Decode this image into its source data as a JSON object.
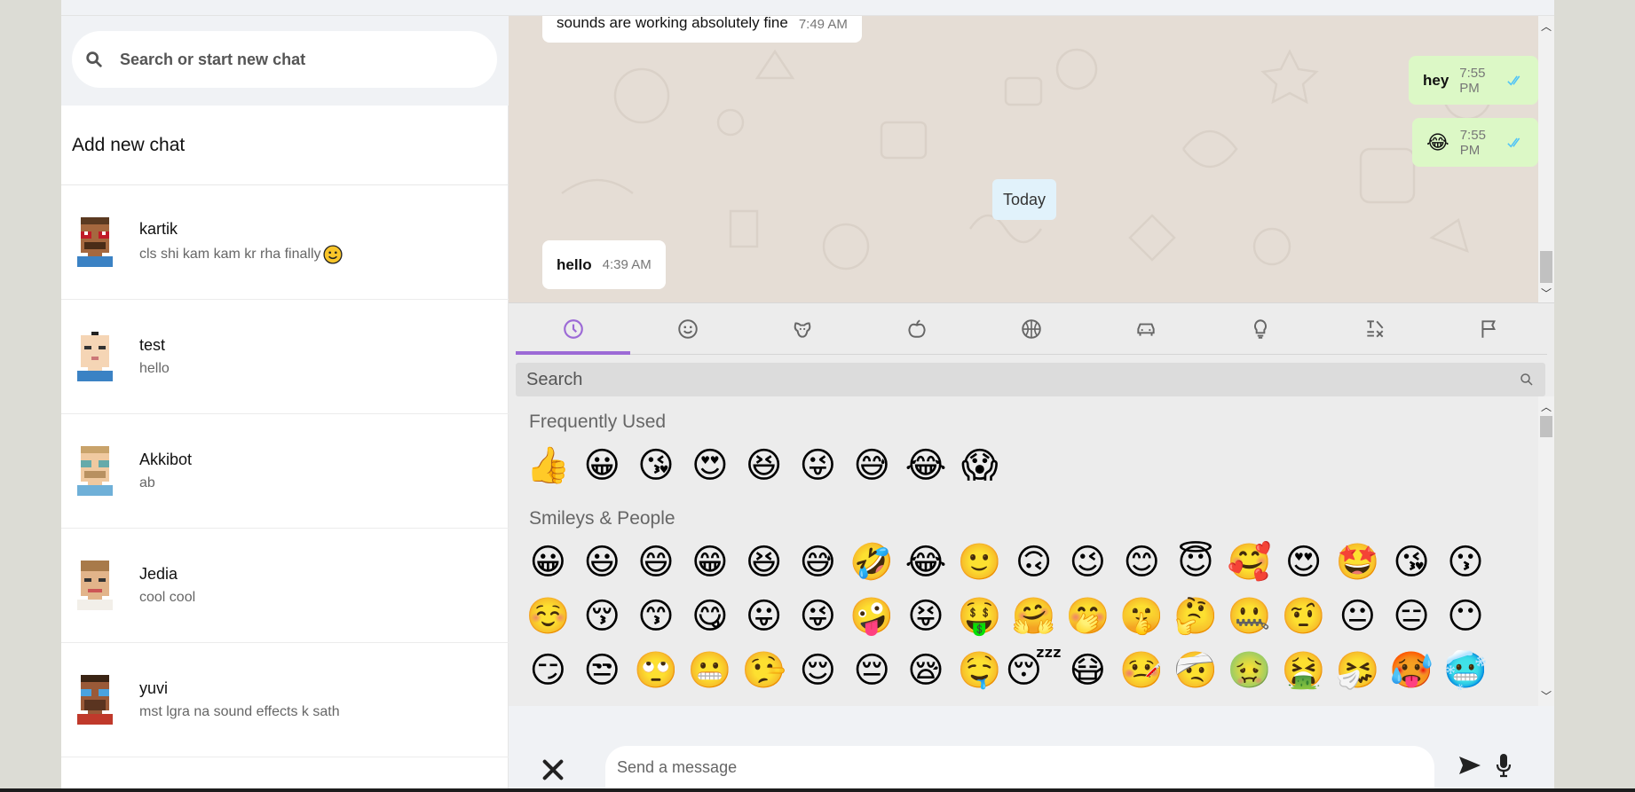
{
  "sidebar": {
    "search_placeholder": "Search or start new chat",
    "add_new_chat": "Add new chat",
    "chats": [
      {
        "name": "kartik",
        "preview": "cls shi kam kam kr rha finally"
      },
      {
        "name": "test",
        "preview": "hello"
      },
      {
        "name": "Akkibot",
        "preview": "ab"
      },
      {
        "name": "Jedia",
        "preview": "cool cool"
      },
      {
        "name": "yuvi",
        "preview": "mst lgra na sound effects k sath"
      }
    ]
  },
  "conversation": {
    "messages": [
      {
        "text": "sounds are working absolutely fine",
        "time": "7:49 AM",
        "direction": "incoming"
      },
      {
        "text": "hey",
        "time": "7:55 PM",
        "direction": "outgoing"
      },
      {
        "text": "😂",
        "time": "7:55 PM",
        "direction": "outgoing"
      },
      {
        "text": "hello",
        "time": "4:39 AM",
        "direction": "incoming"
      }
    ],
    "day_divider": "Today"
  },
  "emoji_picker": {
    "categories": [
      "recent-icon",
      "smiley-icon",
      "animal-icon",
      "food-icon",
      "activity-icon",
      "travel-icon",
      "objects-icon",
      "symbols-icon",
      "flags-icon"
    ],
    "active_category": "recent-icon",
    "search_placeholder": "Search",
    "frequently_used_title": "Frequently Used",
    "frequently_used": [
      "👍",
      "😀",
      "😘",
      "😍",
      "😆",
      "😜",
      "😅",
      "😂",
      "😱"
    ],
    "smileys_title": "Smileys & People",
    "smileys": [
      "😀",
      "😃",
      "😄",
      "😁",
      "😆",
      "😅",
      "🤣",
      "😂",
      "🙂",
      "🙃",
      "😉",
      "😊",
      "😇",
      "🥰",
      "😍",
      "🤩",
      "😘",
      "😗",
      "☺️",
      "😚",
      "😙",
      "😋",
      "😛",
      "😜",
      "🤪",
      "😝",
      "🤑",
      "🤗",
      "🤭",
      "🤫",
      "🤔",
      "🤐",
      "🤨",
      "😐",
      "😑",
      "😶",
      "😏",
      "😒",
      "🙄",
      "😬",
      "🤥",
      "😌",
      "😔",
      "😪",
      "🤤",
      "😴",
      "😷",
      "🤒",
      "🤕",
      "🤢",
      "🤮",
      "🤧",
      "🥵",
      "🥶"
    ]
  },
  "composer": {
    "placeholder": "Send a message"
  },
  "colors": {
    "accent": "#9c6ad6",
    "outgoing_bubble": "#dcf8c6",
    "read_ticks": "#4fc3f7"
  }
}
